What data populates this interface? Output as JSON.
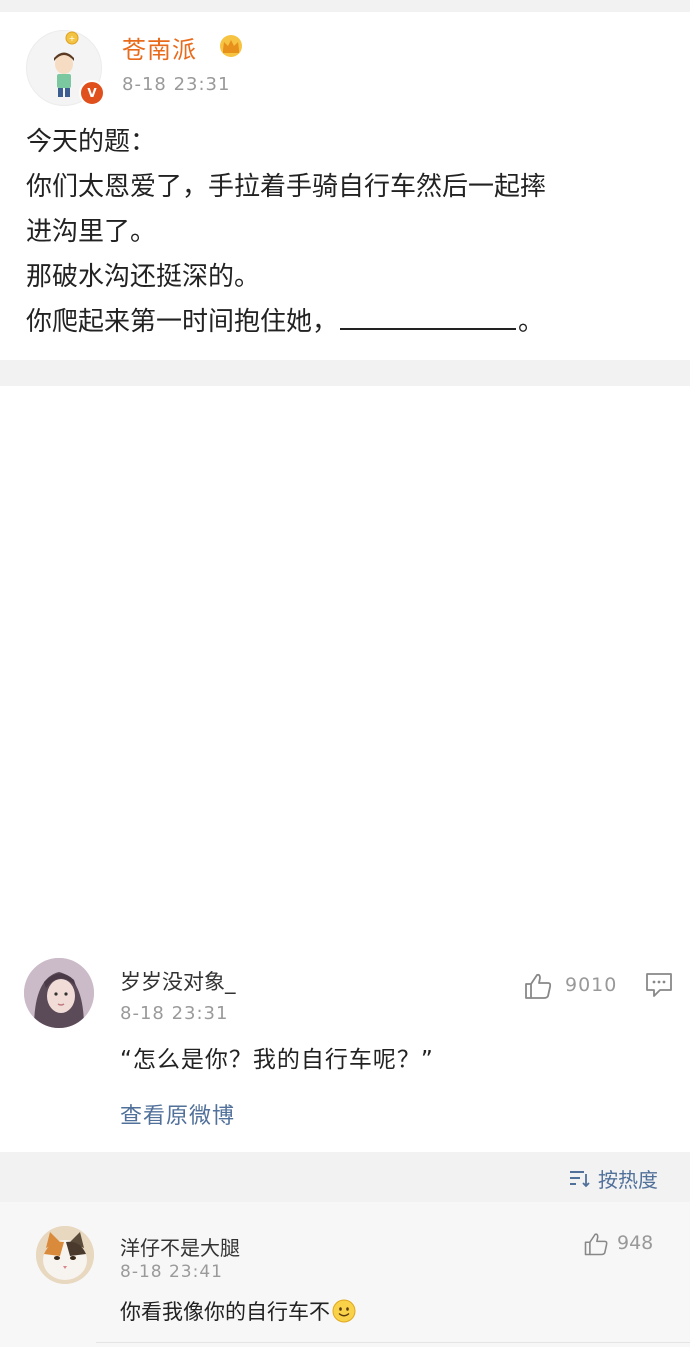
{
  "post": {
    "author": "苍南派",
    "author_badge_icon": "crown-icon",
    "verified_badge": "V",
    "time": "8-18 23:31",
    "lines": [
      "今天的题：",
      "你们太恩爱了，手拉着手骑自行车然后一起摔",
      "进沟里了。",
      "那破水沟还挺深的。"
    ],
    "last_line_prefix": "你爬起来第一时间抱住她，",
    "last_line_suffix": "。"
  },
  "comment1": {
    "author": "岁岁没对象_",
    "time": "8-18 23:31",
    "like_count": "9010",
    "text": "“怎么是你？我的自行车呢？”",
    "view_original": "查看原微博"
  },
  "sort": {
    "label": "按热度"
  },
  "comment2": {
    "author": "洋仔不是大腿",
    "time": "8-18 23:41",
    "like_count": "948",
    "text": "你看我像你的自行车不",
    "emoji_icon": "smiley-icon"
  },
  "colors": {
    "author_orange": "#e86b1c",
    "link_blue": "#51709a",
    "verified_red": "#e0501c"
  }
}
